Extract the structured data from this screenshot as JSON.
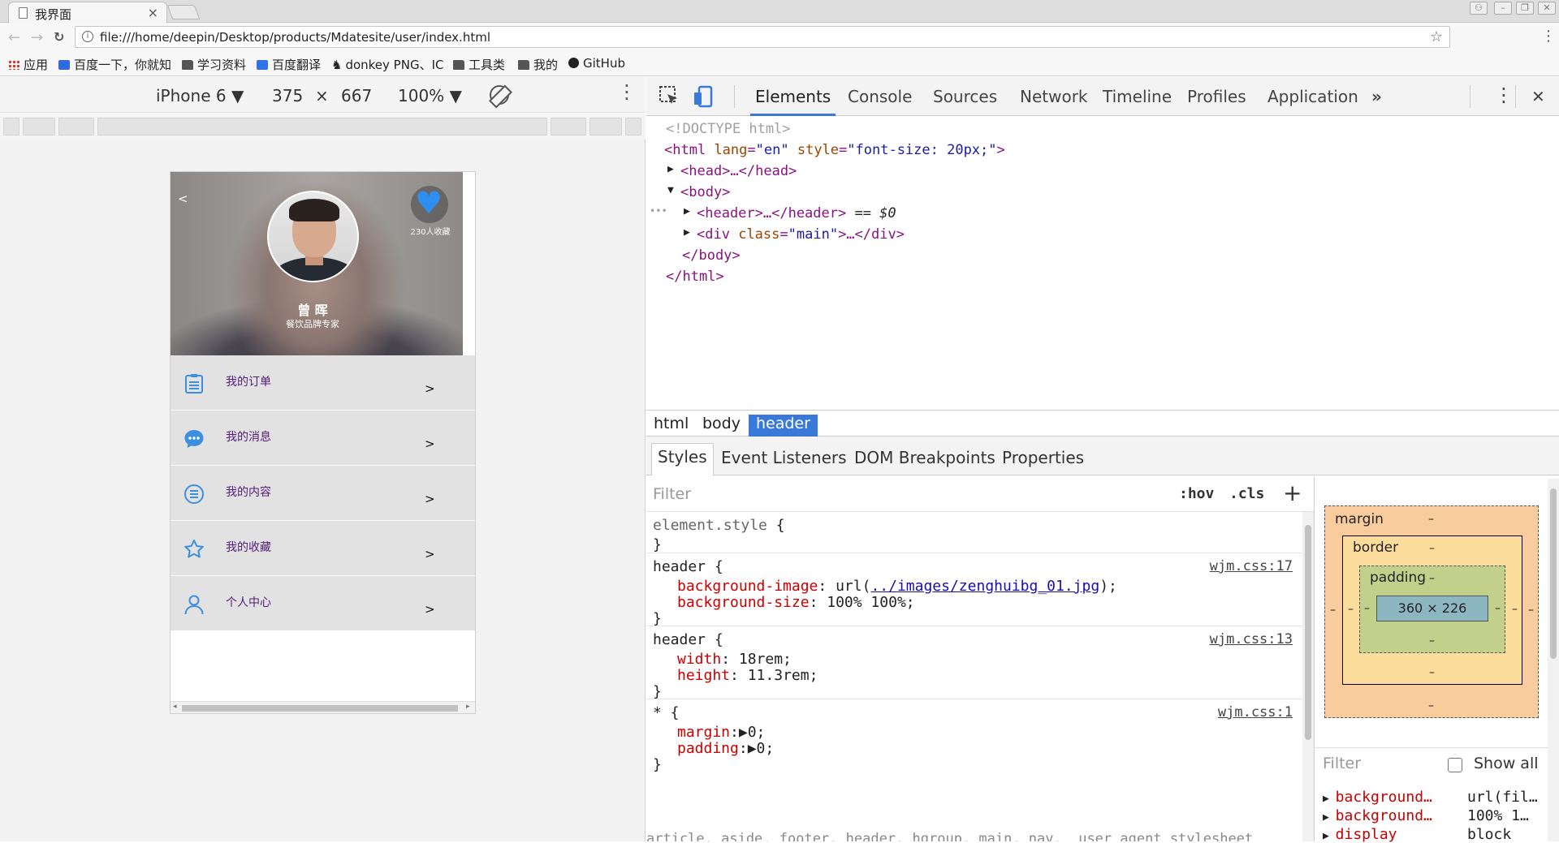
{
  "browser": {
    "tab_title": "我界面",
    "tab_close": "×",
    "back_icon": "←",
    "forward_icon": "→",
    "reload_icon": "C",
    "url": "file:///home/deepin/Desktop/products/Mdatesite/user/index.html",
    "bookmarks": [
      {
        "label": "应用",
        "icon": "apps-icon"
      },
      {
        "label": "百度一下，你就知",
        "icon": "baidu-icon"
      },
      {
        "label": "学习资料",
        "icon": "folder-icon"
      },
      {
        "label": "百度翻译",
        "icon": "translate-icon"
      },
      {
        "label": "donkey PNG、IC",
        "icon": "donkey-icon"
      },
      {
        "label": "工具类",
        "icon": "folder-icon"
      },
      {
        "label": "我的",
        "icon": "folder-icon"
      },
      {
        "label": "GitHub",
        "icon": "github-icon"
      }
    ]
  },
  "device_toolbar": {
    "device": "iPhone 6 ▼",
    "width": "375",
    "times": "×",
    "height": "667",
    "zoom": "100% ▼"
  },
  "page": {
    "back": "<",
    "name": "曾 晖",
    "role": "餐饮品牌专家",
    "fav_count": "230人收藏",
    "menu": [
      {
        "label": "我的订单",
        "icon": "order-list-icon",
        "arrow": ">"
      },
      {
        "label": "我的消息",
        "icon": "message-bubble-icon",
        "arrow": ">"
      },
      {
        "label": "我的内容",
        "icon": "content-list-icon",
        "arrow": ">"
      },
      {
        "label": "我的收藏",
        "icon": "star-icon",
        "arrow": ">"
      },
      {
        "label": "个人中心",
        "icon": "user-icon",
        "arrow": ">"
      }
    ]
  },
  "devtools": {
    "tabs": [
      "Elements",
      "Console",
      "Sources",
      "Network",
      "Timeline",
      "Profiles",
      "Application"
    ],
    "more": "»",
    "close": "✕",
    "dom": {
      "doctype": "<!DOCTYPE html>",
      "html_open": "<html",
      "lang_attr": "lang",
      "lang_val": "\"en\"",
      "style_attr": "style",
      "style_val": "\"font-size: 20px;\"",
      "head": "<head>…</head>",
      "body_open": "<body>",
      "header": "<header>…</header>",
      "eq": " == $0",
      "div_open": "<div",
      "class_attr": "class",
      "class_val": "\"main\"",
      "div_rest": ">…</div>",
      "body_close": "</body>",
      "html_close": "</html>",
      "ellipsis": "•••"
    },
    "breadcrumbs": [
      "html",
      "body",
      "header"
    ],
    "subtabs": [
      "Styles",
      "Event Listeners",
      "DOM Breakpoints",
      "Properties"
    ],
    "filter_placeholder": "Filter",
    "hov": ":hov",
    "cls": ".cls",
    "plus": "+",
    "rules": [
      {
        "selector": "element.style {",
        "close": "}",
        "source": "",
        "decls": []
      },
      {
        "selector": "header {",
        "close": "}",
        "source": "wjm.css:17",
        "decls": [
          {
            "prop": "background-image",
            "pre": "url(",
            "link": "../images/zenghuibg_01.jpg",
            "post": ");"
          },
          {
            "prop": "background-size",
            "value": "100% 100%;"
          }
        ]
      },
      {
        "selector": "header {",
        "close": "}",
        "source": "wjm.css:13",
        "decls": [
          {
            "prop": "width",
            "value": "18rem;"
          },
          {
            "prop": "height",
            "value": "11.3rem;"
          }
        ]
      },
      {
        "selector": "* {",
        "close": "}",
        "source": "wjm.css:1",
        "decls": [
          {
            "prop": "margin",
            "value": "▶0;"
          },
          {
            "prop": "padding",
            "value": "▶0;"
          }
        ]
      }
    ],
    "bottom_selectors": "article, aside, footer, header, hgroup, main, nav,  user agent stylesheet",
    "box_model": {
      "margin": "margin",
      "border": "border",
      "padding": "padding",
      "content": "360 × 226",
      "dash": "–"
    },
    "computed": {
      "filter": "Filter",
      "show_all": "Show all",
      "rows": [
        {
          "prop": "background…",
          "value": "url(fil…"
        },
        {
          "prop": "background…",
          "value": "100% 1…"
        },
        {
          "prop": "display",
          "value": "block"
        }
      ]
    }
  }
}
